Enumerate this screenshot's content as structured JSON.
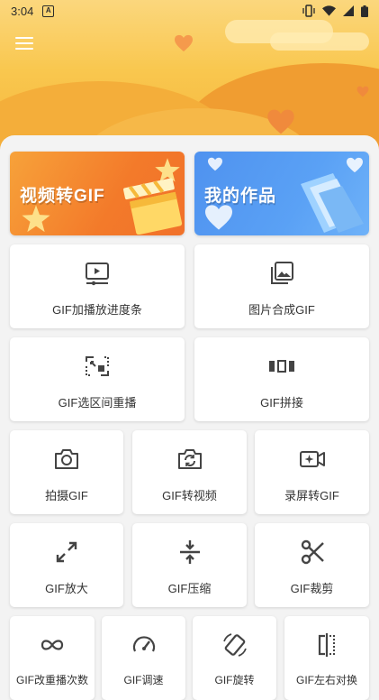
{
  "status_bar": {
    "time": "3:04",
    "app_icon": "A"
  },
  "header": {
    "menu_icon": "hamburger-menu-icon"
  },
  "banners": [
    {
      "label": "视频转GIF",
      "color": "#f37a2a"
    },
    {
      "label": "我的作品",
      "color": "#5aa1f5"
    }
  ],
  "tools": {
    "row1": [
      {
        "label": "GIF加播放进度条",
        "icon": "video-playback-icon"
      },
      {
        "label": "图片合成GIF",
        "icon": "image-gallery-icon"
      }
    ],
    "row2": [
      {
        "label": "GIF选区间重播",
        "icon": "range-replay-icon"
      },
      {
        "label": "GIF拼接",
        "icon": "splice-icon"
      }
    ],
    "row3": [
      {
        "label": "拍摄GIF",
        "icon": "camera-icon"
      },
      {
        "label": "GIF转视频",
        "icon": "camera-switch-icon"
      },
      {
        "label": "录屏转GIF",
        "icon": "screen-record-icon"
      }
    ],
    "row4": [
      {
        "label": "GIF放大",
        "icon": "enlarge-icon"
      },
      {
        "label": "GIF压缩",
        "icon": "compress-icon"
      },
      {
        "label": "GIF裁剪",
        "icon": "scissors-icon"
      }
    ],
    "row5": [
      {
        "label": "GIF改重播次数",
        "icon": "infinity-icon"
      },
      {
        "label": "GIF调速",
        "icon": "speedometer-icon"
      },
      {
        "label": "GIF旋转",
        "icon": "rotate-icon"
      },
      {
        "label": "GIF左右对换",
        "icon": "mirror-flip-icon"
      }
    ]
  }
}
